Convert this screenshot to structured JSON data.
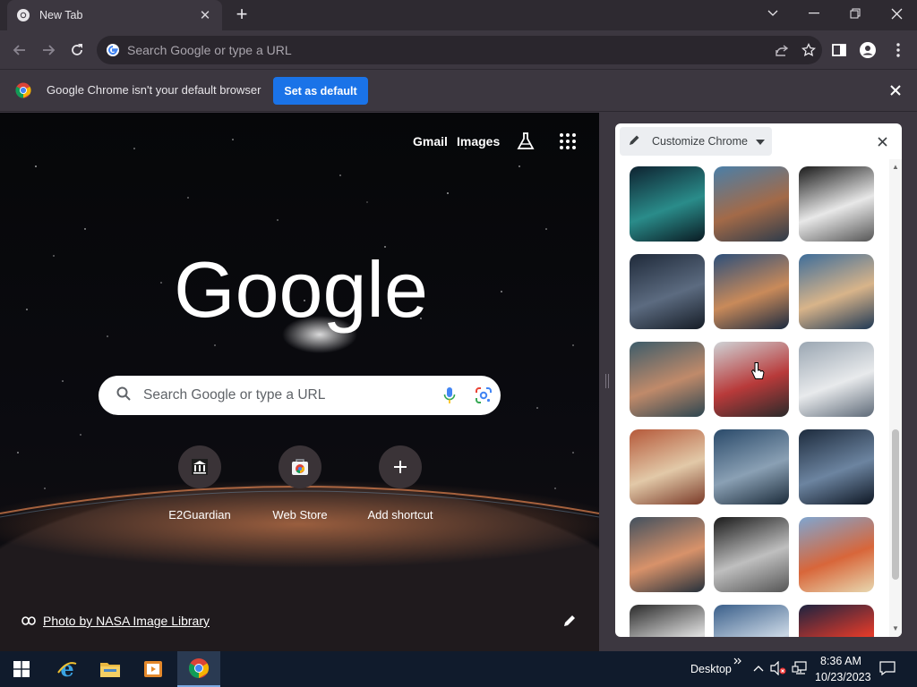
{
  "colors": {
    "accent": "#1a73e8",
    "frame": "#3c3740",
    "tabstrip": "#2e2a31",
    "taskbar": "#101b2c"
  },
  "tab": {
    "title": "New Tab",
    "favicon": "chrome-icon",
    "close_icon": "close-icon"
  },
  "toolbar": {
    "omnibox_placeholder": "Search Google or type a URL",
    "icons": [
      "back-icon",
      "forward-icon",
      "reload-icon",
      "share-icon",
      "star-icon",
      "side-panel-icon",
      "profile-icon",
      "menu-icon"
    ]
  },
  "infobar": {
    "message": "Google Chrome isn't your default browser",
    "button": "Set as default"
  },
  "ntp": {
    "links": {
      "gmail": "Gmail",
      "images": "Images"
    },
    "logo_text": "Google",
    "search_placeholder": "Search Google or type a URL",
    "shortcuts": [
      {
        "label": "E2Guardian",
        "icon": "museum-icon"
      },
      {
        "label": "Web Store",
        "icon": "webstore-icon"
      },
      {
        "label": "Add shortcut",
        "icon": "plus-icon"
      }
    ],
    "attribution": "Photo by NASA Image Library"
  },
  "side_panel": {
    "title": "Customize Chrome",
    "thumbnails": [
      {
        "name": "bridge-night",
        "colors": [
          "#0e2230",
          "#2a8c8a",
          "#0a1a22"
        ]
      },
      {
        "name": "skyscrapers-up",
        "colors": [
          "#4a7fa8",
          "#a36a48",
          "#2d3b4a"
        ]
      },
      {
        "name": "bw-towers",
        "colors": [
          "#1a1a1a",
          "#e8e8e8",
          "#555555"
        ]
      },
      {
        "name": "city-dusk",
        "colors": [
          "#1f2a3a",
          "#5c6b80",
          "#151c26"
        ]
      },
      {
        "name": "harbor-sunset",
        "colors": [
          "#2d4f7a",
          "#c98a5a",
          "#1b2a40"
        ]
      },
      {
        "name": "waterfront-skyline",
        "colors": [
          "#3e6d9a",
          "#d8b48a",
          "#1f3854"
        ]
      },
      {
        "name": "moon-dusk",
        "colors": [
          "#3d5c6a",
          "#c08a6a",
          "#2c4550"
        ]
      },
      {
        "name": "rainy-street",
        "colors": [
          "#cfd3d6",
          "#b83a3a",
          "#2a2a2a"
        ]
      },
      {
        "name": "glass-tower",
        "colors": [
          "#9aa6b2",
          "#e8eaec",
          "#5e6a78"
        ]
      },
      {
        "name": "old-facade",
        "colors": [
          "#b5593a",
          "#e2c9a8",
          "#7a3a28"
        ]
      },
      {
        "name": "aerial-bay",
        "colors": [
          "#2a4a6a",
          "#8aa0b4",
          "#1b2b3a"
        ]
      },
      {
        "name": "aerial-grid",
        "colors": [
          "#1d2b3d",
          "#6c84a0",
          "#0e1724"
        ]
      },
      {
        "name": "pier-sunset",
        "colors": [
          "#42505e",
          "#d8926a",
          "#25303b"
        ]
      },
      {
        "name": "converging-building",
        "colors": [
          "#1a1a1a",
          "#bfbfbf",
          "#555555"
        ]
      },
      {
        "name": "colorful-houses",
        "colors": [
          "#7fa6d1",
          "#d8663a",
          "#e8d8b0"
        ]
      },
      {
        "name": "steel-curve",
        "colors": [
          "#2a2a2a",
          "#dcdcdc",
          "#6a6a6a"
        ]
      },
      {
        "name": "city-block",
        "colors": [
          "#3a5f8a",
          "#c9d6e4",
          "#24384f"
        ]
      },
      {
        "name": "red-balloon",
        "colors": [
          "#1c2340",
          "#e03a2a",
          "#2a335a"
        ]
      }
    ]
  },
  "taskbar": {
    "apps": [
      "windows-start-icon",
      "internet-explorer-icon",
      "file-explorer-icon",
      "media-player-icon",
      "chrome-icon"
    ],
    "desktop_label": "Desktop",
    "time": "8:36 AM",
    "date": "10/23/2023"
  }
}
